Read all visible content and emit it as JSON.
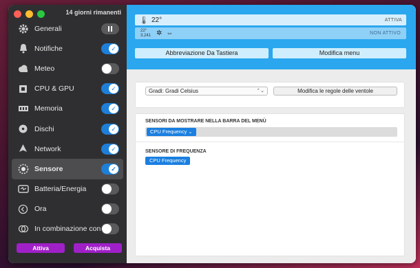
{
  "window": {
    "trial_text": "14 giorni rimanenti"
  },
  "sidebar": {
    "items": [
      {
        "label": "Generali",
        "icon": "gear-icon",
        "control": "pause",
        "selected": false
      },
      {
        "label": "Notifiche",
        "icon": "bell-icon",
        "control": "on",
        "selected": false
      },
      {
        "label": "Meteo",
        "icon": "cloud-icon",
        "control": "off",
        "selected": false
      },
      {
        "label": "CPU & GPU",
        "icon": "chip-icon",
        "control": "on",
        "selected": false
      },
      {
        "label": "Memoria",
        "icon": "memory-icon",
        "control": "on",
        "selected": false
      },
      {
        "label": "Dischi",
        "icon": "disk-icon",
        "control": "on",
        "selected": false
      },
      {
        "label": "Network",
        "icon": "network-icon",
        "control": "on",
        "selected": false
      },
      {
        "label": "Sensore",
        "icon": "fan-icon",
        "control": "on",
        "selected": true
      },
      {
        "label": "Batteria/Energia",
        "icon": "battery-icon",
        "control": "off",
        "selected": false
      },
      {
        "label": "Ora",
        "icon": "clock-icon",
        "control": "off",
        "selected": false
      },
      {
        "label": "In combinazione con",
        "icon": "rings-icon",
        "control": "off",
        "selected": false
      }
    ],
    "activate_label": "Attiva",
    "buy_label": "Acquista"
  },
  "header": {
    "bar1_temp": "22°",
    "bar1_status": "ATTIVA",
    "bar2_line1": "22°",
    "bar2_line2": "3.241",
    "bar2_status": "NON ATTIVO",
    "shortcut_label": "Abbreviazione Da Tastiera",
    "edit_menu_label": "Modifica menu"
  },
  "settings": {
    "unit_select_value": "Gradi: Gradi Celsius",
    "fan_rules_label": "Modifica le regole delle ventole"
  },
  "sensors": {
    "menubar_title": "SENSORI DA MOSTRARE NELLA BARRA DEL MENÙ",
    "menubar_token": "CPU Frequency ⌄",
    "frequency_title": "SENSORE DI FREQUENZA",
    "frequency_token": "CPU Frequency"
  },
  "colors": {
    "accent": "#1e7fd8",
    "header_blue": "#2aa7ee",
    "purchase": "#a020c8"
  }
}
